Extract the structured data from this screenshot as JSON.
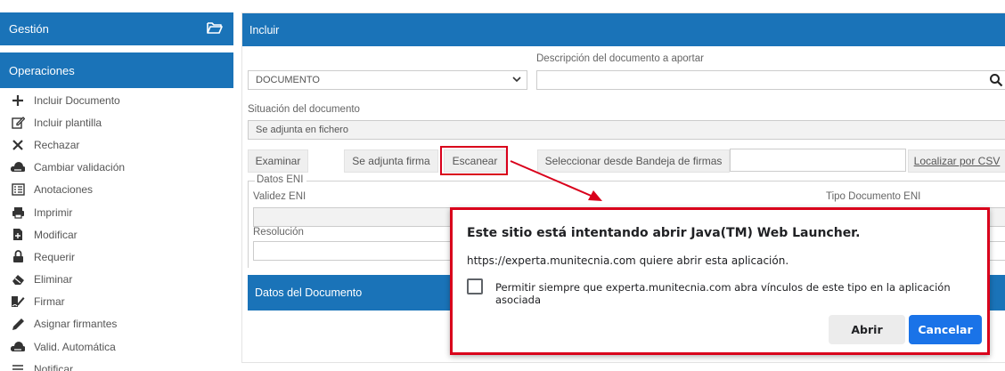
{
  "sidebar": {
    "gestion_label": "Gestión",
    "operaciones_label": "Operaciones",
    "items": [
      {
        "label": "Incluir Documento",
        "icon": "plus-icon"
      },
      {
        "label": "Incluir plantilla",
        "icon": "edit-icon"
      },
      {
        "label": "Rechazar",
        "icon": "close-icon"
      },
      {
        "label": "Cambiar validación",
        "icon": "cloud-icon"
      },
      {
        "label": "Anotaciones",
        "icon": "list-icon"
      },
      {
        "label": "Imprimir",
        "icon": "printer-icon"
      },
      {
        "label": "Modificar",
        "icon": "file-edit-icon"
      },
      {
        "label": "Requerir",
        "icon": "lock-icon"
      },
      {
        "label": "Eliminar",
        "icon": "eraser-icon"
      },
      {
        "label": "Firmar",
        "icon": "signature-icon"
      },
      {
        "label": "Asignar firmantes",
        "icon": "pencil-icon"
      },
      {
        "label": "Valid. Automática",
        "icon": "cloud-icon"
      },
      {
        "label": "Notificar",
        "icon": "menu-icon"
      }
    ]
  },
  "main": {
    "title": "Incluir",
    "documento_select": "DOCUMENTO",
    "descripcion_label": "Descripción del documento a aportar",
    "descripcion_value": "",
    "situacion_label": "Situación del documento",
    "situacion_value": "Se adjunta en fichero",
    "buttons": {
      "examinar": "Examinar",
      "se_adjunta_firma": "Se adjunta firma",
      "escanear": "Escanear",
      "bandeja": "Seleccionar desde Bandeja de firmas",
      "csv_value": "",
      "localizar": "Localizar por CSV"
    },
    "datos_eni_legend": "Datos ENI",
    "validez_label": "Validez ENI",
    "tipo_label": "Tipo Documento ENI",
    "resolucion_label": "Resolución",
    "datos_documento": "Datos del Documento"
  },
  "dialog": {
    "title": "Este sitio está intentando abrir Java(TM) Web Launcher.",
    "message": "https://experta.munitecnia.com quiere abrir esta aplicación.",
    "checkbox_label": "Permitir siempre que experta.munitecnia.com abra vínculos de este tipo en la aplicación asociada",
    "abrir": "Abrir",
    "cancelar": "Cancelar"
  },
  "colors": {
    "primary": "#1a73b8",
    "highlight": "#d9001b",
    "dialog_button": "#1a73e8"
  }
}
